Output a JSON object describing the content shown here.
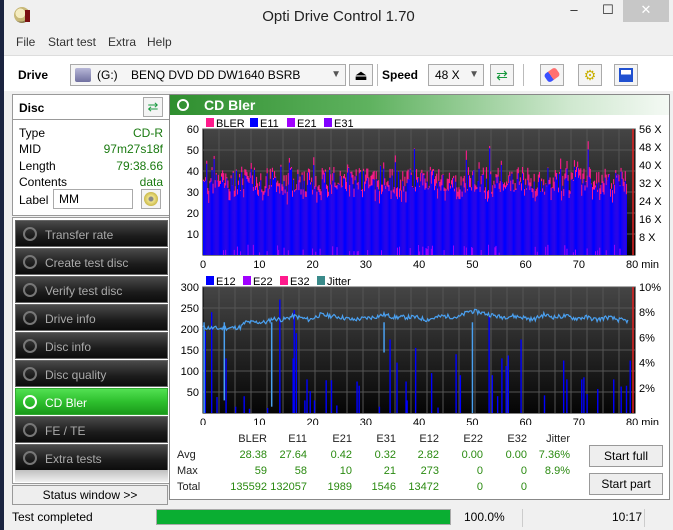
{
  "window": {
    "title": "Opti Drive Control 1.70",
    "minimize": "–",
    "maximize": "☐",
    "close": "✕"
  },
  "menu": [
    "File",
    "Start test",
    "Extra",
    "Help"
  ],
  "toolbar": {
    "drive_label": "Drive",
    "drive_letter": "(G:)",
    "drive_name": "BENQ DVD DD DW1640 BSRB",
    "speed_label": "Speed",
    "speed_value": "48 X",
    "eject_icon": "⏏",
    "refresh_icon": "⇄",
    "erase_icon": "eraser-icon",
    "settings_icon": "gears-icon",
    "save_icon": "save-icon"
  },
  "disc": {
    "title": "Disc",
    "rows": [
      {
        "key": "Type",
        "value": "CD-R"
      },
      {
        "key": "MID",
        "value": "97m27s18f"
      },
      {
        "key": "Length",
        "value": "79:38.66"
      },
      {
        "key": "Contents",
        "value": "data"
      }
    ],
    "label_key": "Label",
    "label_value": "MM"
  },
  "nav": [
    {
      "label": "Transfer rate",
      "active": false
    },
    {
      "label": "Create test disc",
      "active": false
    },
    {
      "label": "Verify test disc",
      "active": false
    },
    {
      "label": "Drive info",
      "active": false
    },
    {
      "label": "Disc info",
      "active": false
    },
    {
      "label": "Disc quality",
      "active": false
    },
    {
      "label": "CD Bler",
      "active": true
    },
    {
      "label": "FE / TE",
      "active": false
    },
    {
      "label": "Extra tests",
      "active": false
    }
  ],
  "status_window_button": "Status window >>",
  "panel_title": "CD Bler",
  "chart_data": [
    {
      "type": "bar",
      "title": "",
      "legend": [
        "BLER",
        "E11",
        "E21",
        "E31"
      ],
      "legend_colors": [
        "#ff1a8c",
        "#0000ff",
        "#a000ff",
        "#8000ff"
      ],
      "legend_placement": "top-left",
      "xlabel": "min",
      "xlim": [
        0,
        80
      ],
      "x_ticks": [
        "0",
        "10",
        "20",
        "30",
        "40",
        "50",
        "60",
        "70",
        "80 min"
      ],
      "ylim": [
        0,
        60
      ],
      "y_ticks": [
        "10",
        "20",
        "30",
        "40",
        "50",
        "60"
      ],
      "y2_ticks": [
        "8 X",
        "16 X",
        "24 X",
        "32 X",
        "40 X",
        "48 X",
        "56 X"
      ],
      "y2lim": [
        0,
        56
      ],
      "series": [
        {
          "name": "BLER",
          "typical_range": [
            30,
            42
          ],
          "max": 59,
          "avg": 28.38
        },
        {
          "name": "E11",
          "typical_range": [
            28,
            40
          ],
          "max": 58,
          "avg": 27.64
        },
        {
          "name": "E21",
          "max": 10,
          "avg": 0.42
        },
        {
          "name": "E31",
          "max": 21,
          "avg": 0.32
        }
      ]
    },
    {
      "type": "bar",
      "title": "",
      "legend": [
        "E12",
        "E22",
        "E32",
        "Jitter"
      ],
      "legend_colors": [
        "#0000ff",
        "#a000ff",
        "#ff1a8c",
        "#3a8a8a"
      ],
      "legend_placement": "top-left",
      "xlabel": "min",
      "xlim": [
        0,
        80
      ],
      "x_ticks": [
        "0",
        "10",
        "20",
        "30",
        "40",
        "50",
        "60",
        "70",
        "80 min"
      ],
      "ylim": [
        0,
        300
      ],
      "y_ticks": [
        "50",
        "100",
        "150",
        "200",
        "250",
        "300"
      ],
      "y2_ticks": [
        "2%",
        "4%",
        "6%",
        "8%",
        "10%"
      ],
      "y2lim": [
        0,
        10
      ],
      "e12_spikes": [
        [
          0.3,
          195
        ],
        [
          1.5,
          240
        ],
        [
          2.5,
          38
        ],
        [
          4.2,
          130
        ],
        [
          6,
          15
        ],
        [
          7.6,
          40
        ],
        [
          8.6,
          10
        ],
        [
          12,
          12
        ],
        [
          14.3,
          270
        ],
        [
          16.8,
          130
        ],
        [
          17,
          245
        ],
        [
          17.4,
          190
        ],
        [
          19,
          30
        ],
        [
          19.4,
          80
        ],
        [
          20,
          52
        ],
        [
          20.8,
          30
        ],
        [
          23,
          78
        ],
        [
          24,
          78
        ],
        [
          25,
          18
        ],
        [
          28.8,
          75
        ],
        [
          29.2,
          65
        ],
        [
          33,
          15
        ],
        [
          35,
          175
        ],
        [
          36.3,
          120
        ],
        [
          38,
          75
        ],
        [
          38.2,
          30
        ],
        [
          39.8,
          155
        ],
        [
          42.8,
          95
        ],
        [
          44,
          13
        ],
        [
          47.4,
          140
        ],
        [
          48.2,
          90
        ],
        [
          53.6,
          230
        ],
        [
          54.2,
          90
        ],
        [
          55.2,
          40
        ],
        [
          56,
          130
        ],
        [
          56.8,
          112
        ],
        [
          57.2,
          137
        ],
        [
          59.6,
          175
        ],
        [
          64,
          42
        ],
        [
          67.6,
          125
        ],
        [
          68.2,
          80
        ],
        [
          71,
          80
        ],
        [
          71.4,
          85
        ],
        [
          72,
          45
        ],
        [
          74,
          57
        ],
        [
          77,
          80
        ],
        [
          78.4,
          63
        ],
        [
          79.4,
          65
        ],
        [
          80.1,
          125
        ]
      ],
      "jitter_percent_path": [
        [
          0,
          6.8
        ],
        [
          3,
          6.7
        ],
        [
          7,
          6.8
        ],
        [
          8,
          7.2
        ],
        [
          12,
          7.2
        ],
        [
          13,
          7.5
        ],
        [
          15,
          7.4
        ],
        [
          17,
          7.7
        ],
        [
          20,
          7.4
        ],
        [
          22,
          7.8
        ],
        [
          24,
          7.7
        ],
        [
          26,
          7.6
        ],
        [
          28,
          7.4
        ],
        [
          30,
          7.5
        ],
        [
          32,
          7.6
        ],
        [
          34,
          7.8
        ],
        [
          36,
          7.6
        ],
        [
          40,
          7.6
        ],
        [
          42,
          7.4
        ],
        [
          45,
          7.7
        ],
        [
          48,
          7.6
        ],
        [
          50,
          8.1
        ],
        [
          52,
          8.0
        ],
        [
          54,
          7.8
        ],
        [
          56,
          7.6
        ],
        [
          58,
          7.7
        ],
        [
          60,
          7.6
        ],
        [
          62,
          7.4
        ],
        [
          64,
          7.8
        ],
        [
          66,
          7.6
        ],
        [
          68,
          7.7
        ],
        [
          70,
          7.5
        ],
        [
          72,
          7.6
        ],
        [
          74,
          7.4
        ],
        [
          76,
          7.6
        ],
        [
          78,
          7.4
        ],
        [
          80,
          7.3
        ]
      ],
      "jitter_dips": [
        [
          0.2,
          0
        ],
        [
          4,
          1
        ],
        [
          12.9,
          0.5
        ],
        [
          34,
          4.8
        ],
        [
          50.6,
          0
        ]
      ]
    }
  ],
  "stats": {
    "columns": [
      "BLER",
      "E11",
      "E21",
      "E31",
      "E12",
      "E22",
      "E32",
      "Jitter"
    ],
    "rows": [
      {
        "label": "Avg",
        "values": [
          "28.38",
          "27.64",
          "0.42",
          "0.32",
          "2.82",
          "0.00",
          "0.00",
          "7.36%"
        ]
      },
      {
        "label": "Max",
        "values": [
          "59",
          "58",
          "10",
          "21",
          "273",
          "0",
          "0",
          "8.9%"
        ]
      },
      {
        "label": "Total",
        "values": [
          "135592",
          "132057",
          "1989",
          "1546",
          "13472",
          "0",
          "0",
          ""
        ]
      }
    ]
  },
  "buttons": {
    "start_full": "Start full",
    "start_part": "Start part"
  },
  "statusbar": {
    "text": "Test completed",
    "progress": 100.0,
    "progress_text": "100.0%",
    "time": "10:17"
  }
}
